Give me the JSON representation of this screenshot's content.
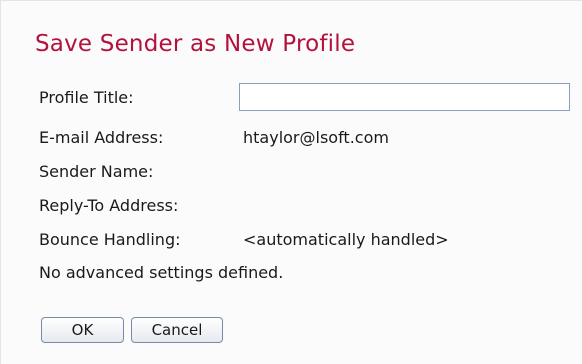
{
  "dialog": {
    "title": "Save Sender as New Profile"
  },
  "form": {
    "profile_title_label": "Profile Title:",
    "profile_title_value": "",
    "email_label": "E-mail Address:",
    "email_value": "htaylor@lsoft.com",
    "sender_name_label": "Sender Name:",
    "reply_to_label": "Reply-To Address:",
    "bounce_label": "Bounce Handling:",
    "bounce_value": "<automatically handled>",
    "advanced_note": "No advanced settings defined."
  },
  "buttons": {
    "ok_label": "OK",
    "cancel_label": "Cancel"
  },
  "colors": {
    "title": "#b3123d",
    "input_border": "#8aa0c0"
  }
}
